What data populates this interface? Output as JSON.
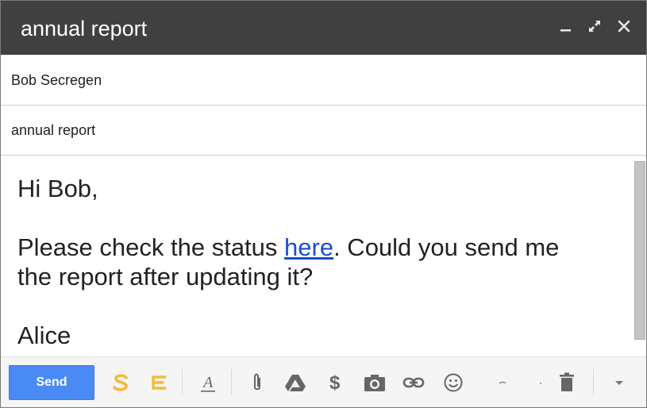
{
  "window": {
    "title": "annual report",
    "controls": [
      "minimize-icon",
      "expand-icon",
      "close-icon"
    ]
  },
  "fields": {
    "recipient": "Bob Secregen",
    "subject": "annual report"
  },
  "body": {
    "greeting": "Hi Bob,",
    "line1_before_link": "Please check the status ",
    "link_text": "here",
    "line1_after_link": ". Could you send me",
    "line2": "the report after updating it?",
    "signature": "Alice"
  },
  "toolbar": {
    "send_label": "Send",
    "icons": [
      "streak-s-icon",
      "streak-e-icon",
      "formatting-icon",
      "attach-icon",
      "drive-icon",
      "dollar-icon",
      "camera-icon",
      "link-icon",
      "emoji-icon",
      "more-options-icon",
      "discard-icon",
      "dropdown-icon"
    ]
  },
  "colors": {
    "titlebar": "#404040",
    "send_button": "#4a8af4",
    "link": "#1a4fcc",
    "streak_yellow": "#f6b93b"
  }
}
